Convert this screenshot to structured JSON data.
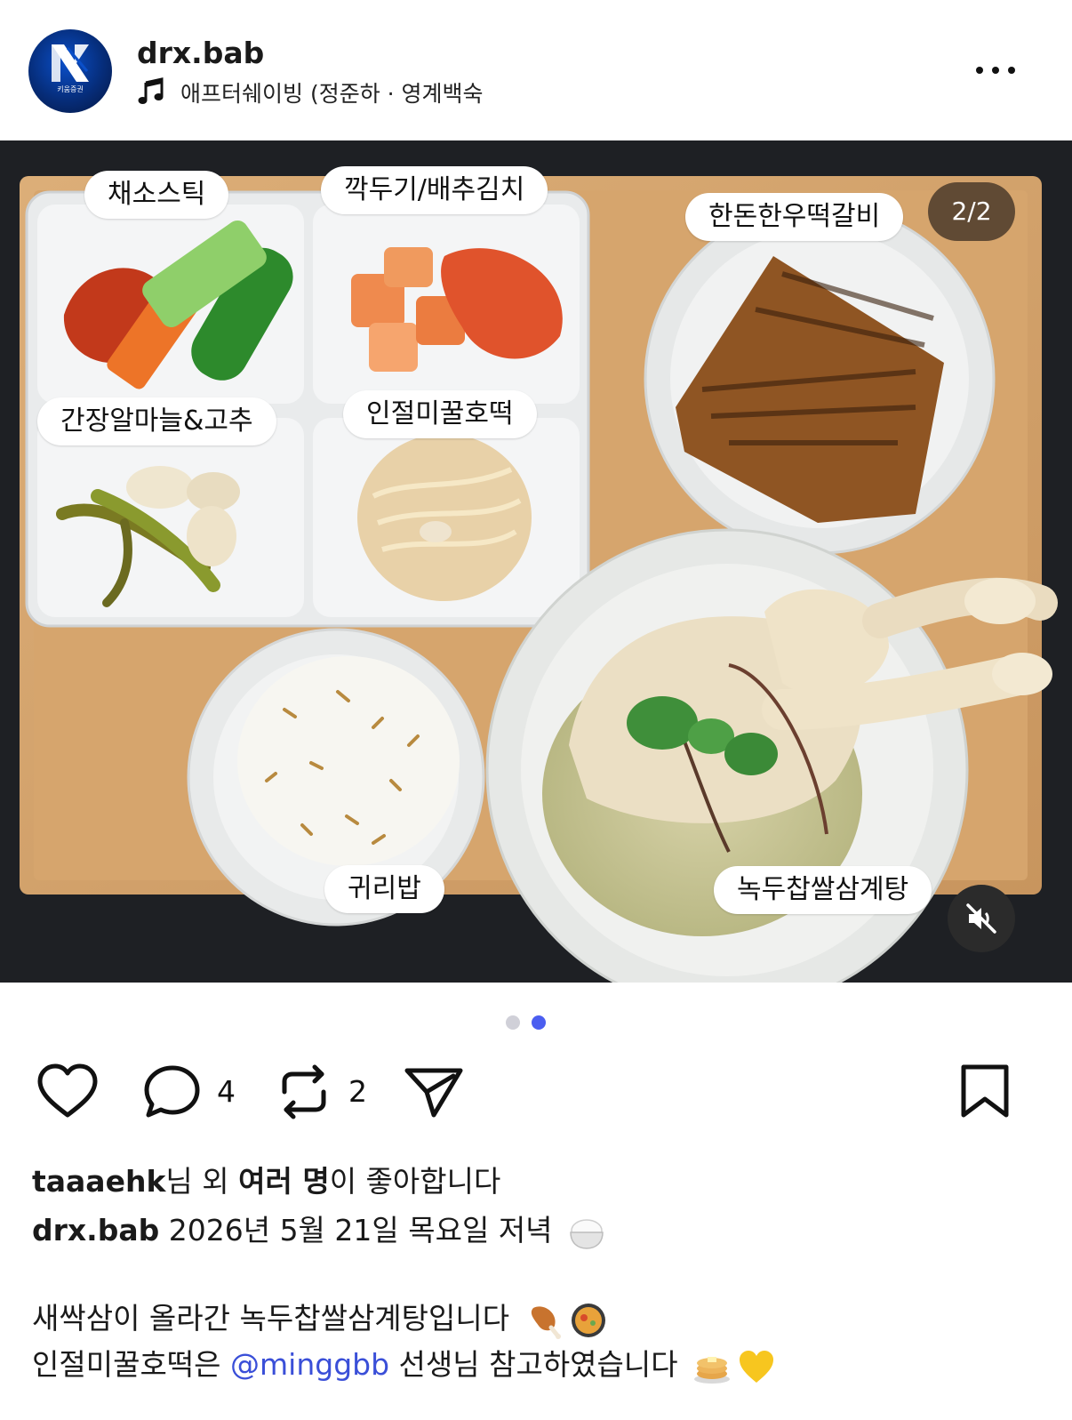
{
  "post": {
    "username": "drx.bab",
    "avatar_caption": "키움증권",
    "music": "애프터쉐이빙 (정준하 · 영계백숙",
    "image_counter": "2/2",
    "food_tags": {
      "veg_sticks": "채소스틱",
      "kimchi": "깍두기/배추김치",
      "galbi": "한돈한우떡갈비",
      "garlic_pepper": "간장알마늘&고추",
      "hotteok": "인절미꿀호떡",
      "rice": "귀리밥",
      "samgyetang": "녹두찹쌀삼계탕"
    },
    "carousel": {
      "total": 2,
      "active": 2
    },
    "comment_count": "4",
    "repost_count": "2",
    "likes": {
      "user": "taaaehk",
      "mid1": "님 외 ",
      "others": "여러 명",
      "tail": "이 좋아합니다"
    },
    "caption_head": "2026년 5월 21일 목요일 저녁",
    "caption_line1": "새싹삼이 올라간 녹두찹쌀삼계탕입니다",
    "caption_line2_pre": "인절미꿀호떡은 ",
    "caption_mention": "@minggbb",
    "caption_line2_post": " 선생님 참고하였습니다",
    "icons": [
      "music-note-icon",
      "more-icon",
      "mute-icon",
      "heart-icon",
      "comment-icon",
      "repost-icon",
      "send-icon",
      "bookmark-icon",
      "rice-bowl-emoji",
      "drumstick-emoji",
      "pan-food-emoji",
      "pancakes-emoji",
      "yellow-heart-emoji"
    ],
    "colors": {
      "active_dot": "#4b5ef0",
      "inactive_dot": "#d0d0d8",
      "mention": "#3a4fd8"
    }
  }
}
